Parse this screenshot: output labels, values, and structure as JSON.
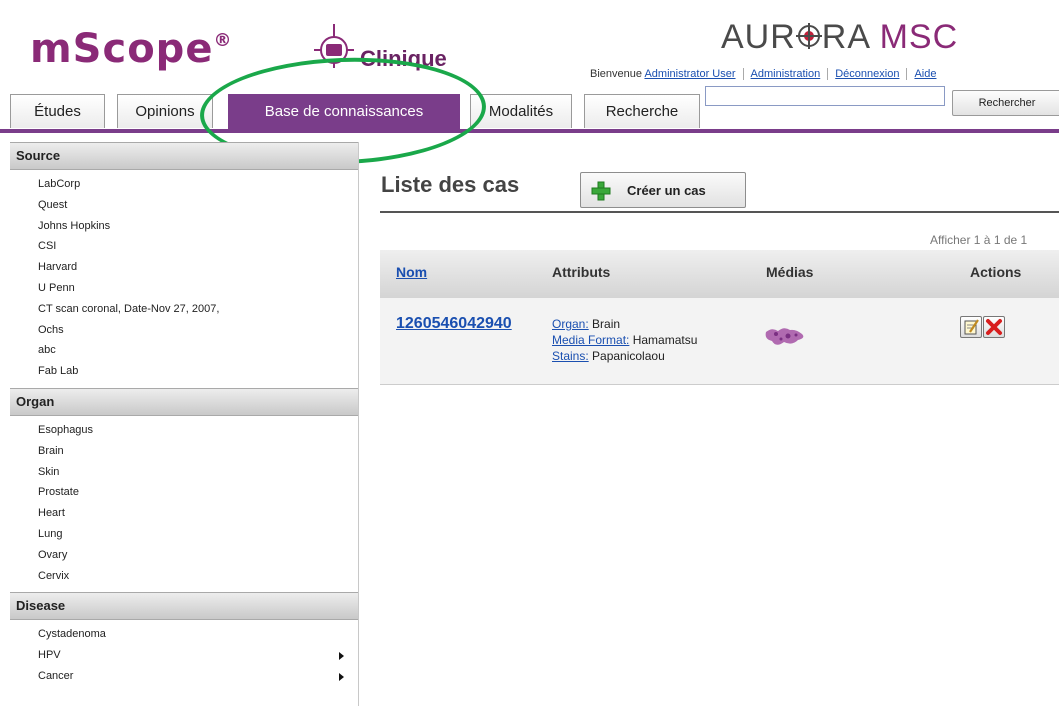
{
  "header": {
    "logo_text": "mScope",
    "logo_reg": "®",
    "logo_sub": "Clinique",
    "brand_left": "AUR",
    "brand_mid": "RA ",
    "brand_right": "MSC",
    "welcome": "Bienvenue",
    "user_link": "Administrator User",
    "admin_link": "Administration",
    "logout_link": "Déconnexion",
    "help_link": "Aide",
    "search_value": "",
    "search_button": "Rechercher",
    "accent_color": "#7a3d8a"
  },
  "tabs": [
    {
      "label": "Études"
    },
    {
      "label": "Opinions"
    },
    {
      "label": "Base de connaissances",
      "active": true
    },
    {
      "label": "Modalités"
    },
    {
      "label": "Recherche"
    }
  ],
  "sidebar": {
    "sections": [
      {
        "title": "Source",
        "items": [
          "LabCorp",
          "Quest",
          "Johns Hopkins",
          "CSI",
          "Harvard",
          "U Penn",
          "CT scan coronal, Date-Nov 27, 2007,",
          "Ochs",
          "abc",
          "Fab Lab"
        ]
      },
      {
        "title": "Organ",
        "items": [
          "Esophagus",
          "Brain",
          "Skin",
          "Prostate",
          "Heart",
          "Lung",
          "Ovary",
          "Cervix"
        ]
      },
      {
        "title": "Disease",
        "items": [
          "Cystadenoma",
          "HPV",
          "Cancer"
        ],
        "submenu": [
          false,
          true,
          true
        ]
      }
    ]
  },
  "main": {
    "title": "Liste des cas",
    "create_button": "Créer un cas",
    "pager": "Afficher 1 à 1 de 1",
    "columns": {
      "name": "Nom",
      "attributes": "Attributs",
      "media": "Médias",
      "actions": "Actions"
    },
    "row": {
      "id": "1260546042940",
      "organ_key": "Organ:",
      "organ_val": " Brain",
      "format_key": "Media Format:",
      "format_val": " Hamamatsu",
      "stains_key": "Stains:",
      "stains_val": " Papanicolaou"
    }
  },
  "icons": [
    "logo-cross-icon",
    "aurora-o-icon",
    "plus-icon",
    "edit-icon",
    "delete-icon",
    "submenu-arrow-icon"
  ]
}
